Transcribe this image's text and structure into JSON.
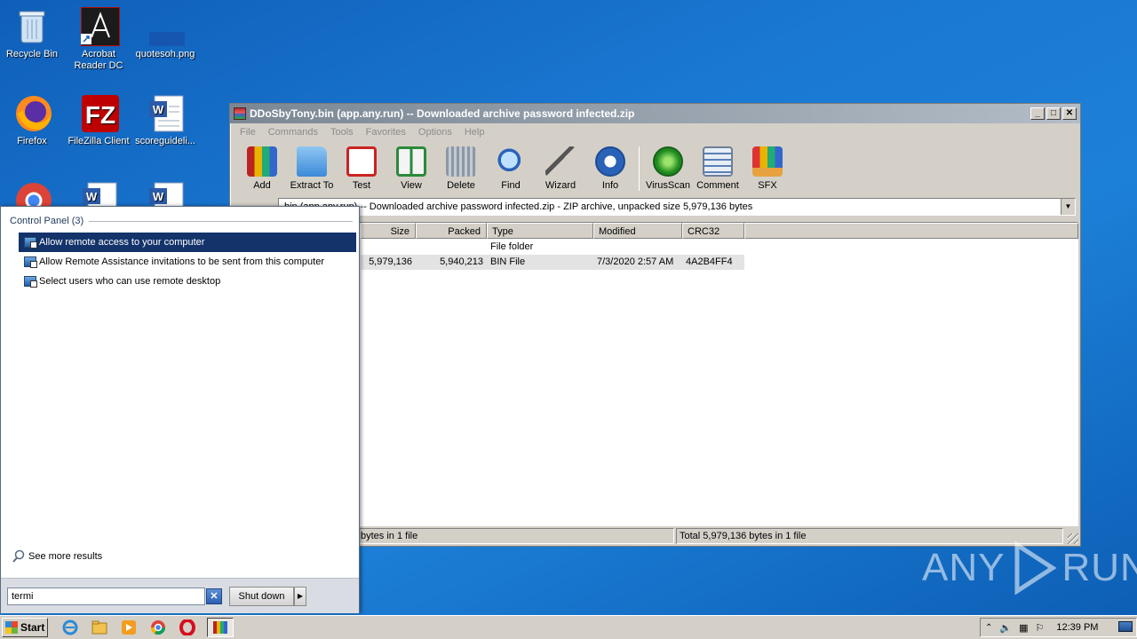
{
  "desktop": {
    "icons": [
      {
        "label": "Recycle Bin",
        "icon": "recycle-bin-icon"
      },
      {
        "label": "Acrobat Reader DC",
        "icon": "acrobat-icon"
      },
      {
        "label": "quotesoh.png",
        "icon": "image-file-icon"
      },
      {
        "label": "Firefox",
        "icon": "firefox-icon"
      },
      {
        "label": "FileZilla Client",
        "icon": "filezilla-icon"
      },
      {
        "label": "scoreguideli...",
        "icon": "word-doc-icon"
      }
    ]
  },
  "winrar": {
    "title": "DDoSbyTony.bin (app.any.run) -- Downloaded archive password infected.zip",
    "menu": [
      "File",
      "Commands",
      "Tools",
      "Favorites",
      "Options",
      "Help"
    ],
    "toolbar": [
      "Add",
      "Extract To",
      "Test",
      "View",
      "Delete",
      "Find",
      "Wizard",
      "Info",
      "VirusScan",
      "Comment",
      "SFX"
    ],
    "path": "bin (app.any.run) -- Downloaded archive password infected.zip - ZIP archive, unpacked size 5,979,136 bytes",
    "columns": [
      "Size",
      "Packed",
      "Type",
      "Modified",
      "CRC32"
    ],
    "rows": [
      {
        "size": "",
        "packed": "",
        "type": "File folder",
        "modified": "",
        "crc": ""
      },
      {
        "size": "5,979,136",
        "packed": "5,940,213",
        "type": "BIN File",
        "modified": "7/3/2020 2:57 AM",
        "crc": "4A2B4FF4"
      }
    ],
    "status_left": "bytes in 1 file",
    "status_right": "Total 5,979,136 bytes in 1 file"
  },
  "startmenu": {
    "group": "Control Panel (3)",
    "items": [
      "Allow remote access to your computer",
      "Allow Remote Assistance invitations to be sent from this computer",
      "Select users who can use remote desktop"
    ],
    "see_more": "See more results",
    "search_value": "termi",
    "shutdown": "Shut down"
  },
  "taskbar": {
    "start": "Start",
    "clock": "12:39 PM"
  },
  "watermark": {
    "left": "ANY",
    "right": "RUN"
  }
}
